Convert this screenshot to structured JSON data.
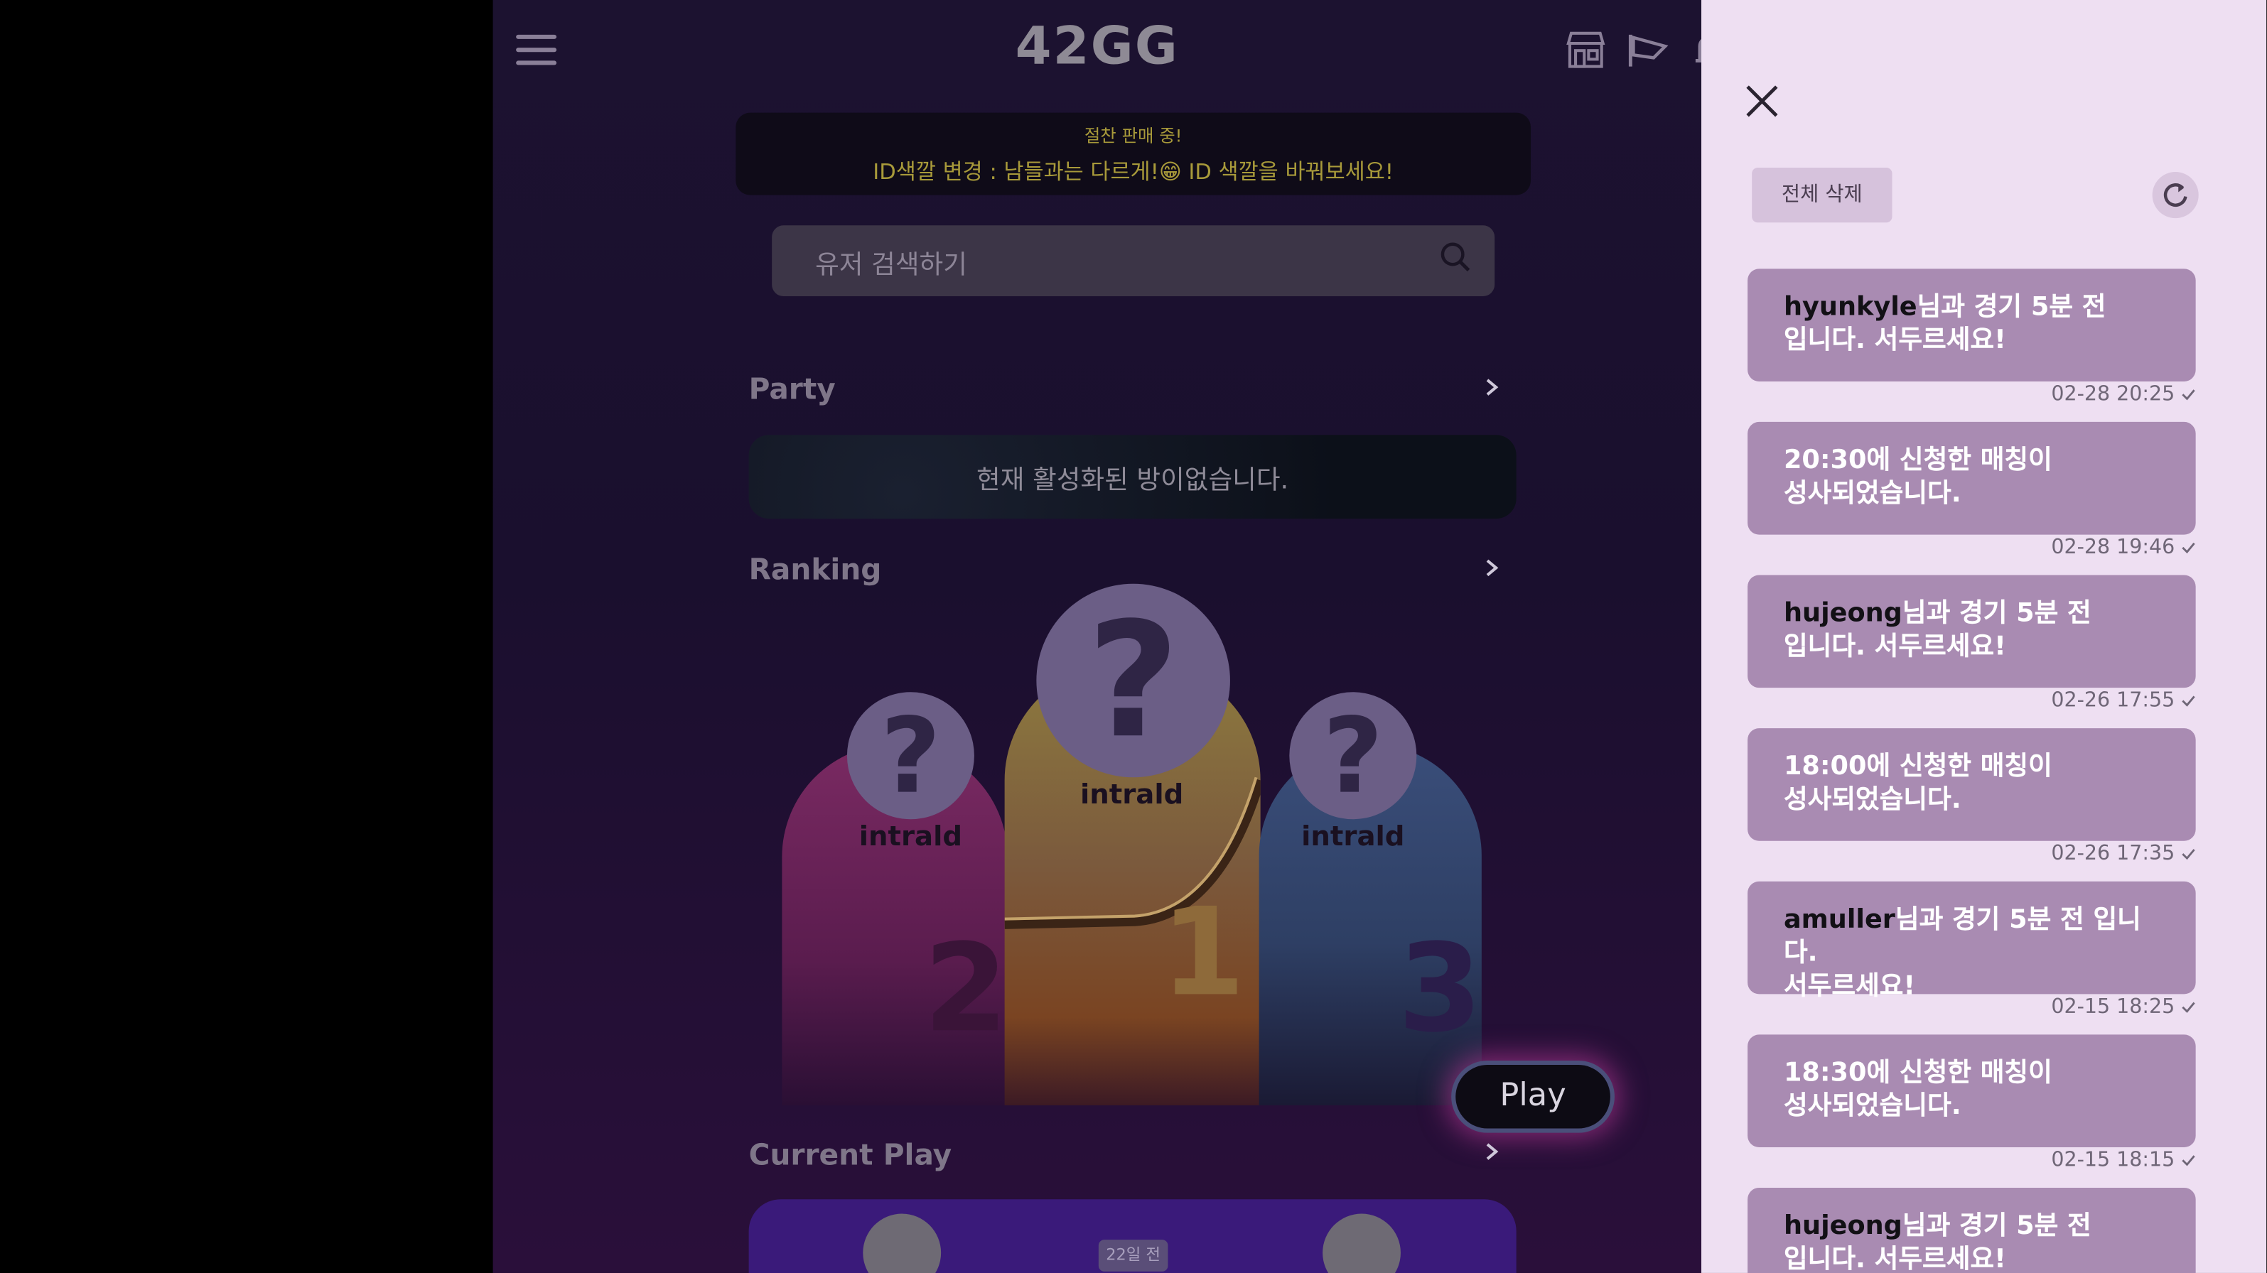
{
  "app": {
    "logo": "42GG",
    "notice": {
      "title": "절찬 판매 중!",
      "text": "ID색깔 변경 : 남들과는 다르게!😁 ID 색깔을 바꿔보세요!"
    },
    "search": {
      "placeholder": "유저 검색하기"
    },
    "sections": {
      "party": "Party",
      "ranking": "Ranking",
      "current_play": "Current Play"
    },
    "party_empty": "현재 활성화된 방이없습니다.",
    "ranking": [
      {
        "rank": "2",
        "name": "intrald"
      },
      {
        "rank": "1",
        "name": "intrald"
      },
      {
        "rank": "3",
        "name": "intrald"
      }
    ],
    "play_button": "Play",
    "current_play": {
      "time_ago": "22일 전"
    }
  },
  "panel": {
    "delete_all": "전체 삭제",
    "notifications": [
      {
        "user": "hyunkyle",
        "line1": "님과 경기 5분 전",
        "line2": "입니다. 서두르세요!",
        "time": "02-28 20:25"
      },
      {
        "user": "",
        "line1": "20:30에 신청한 매칭이",
        "line2": "성사되었습니다.",
        "time": "02-28 19:46"
      },
      {
        "user": "hujeong",
        "line1": "님과 경기 5분 전",
        "line2": "입니다. 서두르세요!",
        "time": "02-26 17:55"
      },
      {
        "user": "",
        "line1": "18:00에 신청한 매칭이",
        "line2": "성사되었습니다.",
        "time": "02-26 17:35"
      },
      {
        "user": "amuller",
        "line1": "님과 경기 5분 전 입니다.",
        "line2": "서두르세요!",
        "time": "02-15 18:25"
      },
      {
        "user": "",
        "line1": "18:30에 신청한 매칭이",
        "line2": "성사되었습니다.",
        "time": "02-15 18:15"
      },
      {
        "user": "hujeong",
        "line1": "님과 경기 5분 전",
        "line2": "입니다. 서두르세요!",
        "time": ""
      }
    ]
  }
}
